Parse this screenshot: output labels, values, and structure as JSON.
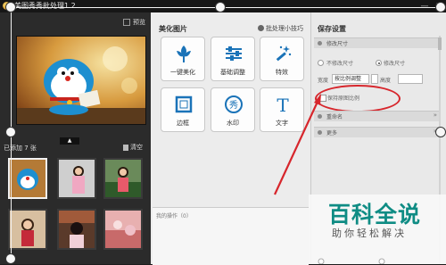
{
  "window": {
    "title": "美图秀秀批处理1.2",
    "minimize_label": "—",
    "close_label": "✕"
  },
  "left_panel": {
    "preview_label": "预览",
    "added_label": "已添加 7 张",
    "clear_label": "清空",
    "collapse_glyph": "▲"
  },
  "middle_panel": {
    "title": "美化图片",
    "tips_label": "批处理小技巧",
    "tools": [
      {
        "label": "一键美化",
        "icon": "flower-icon"
      },
      {
        "label": "基础调整",
        "icon": "sliders-icon"
      },
      {
        "label": "特效",
        "icon": "magic-wand-icon"
      },
      {
        "label": "边框",
        "icon": "frame-icon"
      },
      {
        "label": "水印",
        "icon": "watermark-badge-icon",
        "glyph": "秀"
      },
      {
        "label": "文字",
        "icon": "text-icon",
        "glyph": "T"
      }
    ],
    "operations_label": "我的操作（0）"
  },
  "right_panel": {
    "title": "保存设置",
    "section_size": "修改尺寸",
    "radio_keep": "不修改尺寸",
    "radio_change": "修改尺寸",
    "width_label": "宽度",
    "scale_select": "按比例调整",
    "height_label": "高度",
    "keep_ratio_label": "保持原图比例",
    "section_rename": "重命名",
    "section_more": "更多",
    "chevron": "»"
  },
  "watermark": {
    "title": "百科全说",
    "subtitle": "助你轻松解决"
  },
  "colors": {
    "accent_red": "#d7262c",
    "watermark_teal": "#0f8c84",
    "dark_panel": "#2b2b2b"
  }
}
